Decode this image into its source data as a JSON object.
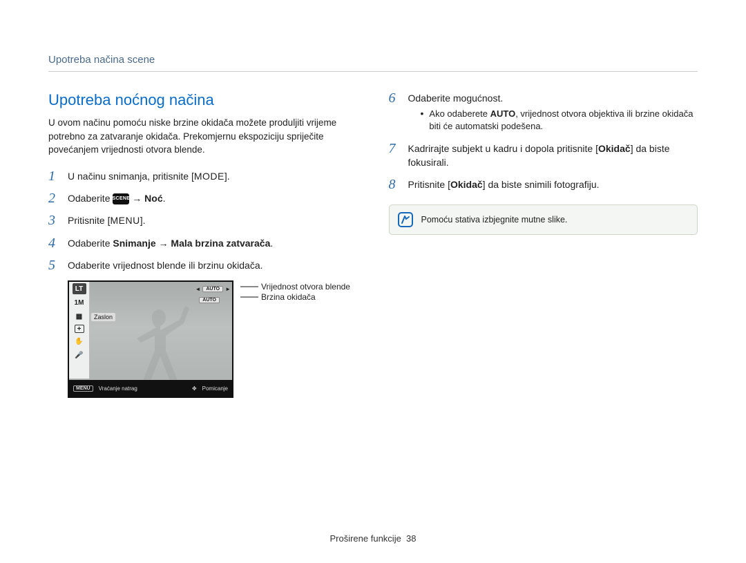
{
  "header": {
    "breadcrumb": "Upotreba načina scene"
  },
  "title": "Upotreba noćnog načina",
  "intro": "U ovom načinu pomoću niske brzine okidača možete produljiti vrijeme potrebno za zatvaranje okidača. Prekomjernu ekspoziciju spriječite povećanjem vrijednosti otvora blende.",
  "steps_left": {
    "s1_pre": "U načinu snimanja, pritisnite [",
    "s1_btn": "MODE",
    "s1_post": "].",
    "s2_pre": "Odaberite ",
    "s2_badge": "SCENE",
    "s2_arrow": " → ",
    "s2_bold": "Noć",
    "s2_post": ".",
    "s3_pre": "Pritisnite [",
    "s3_btn": "MENU",
    "s3_post": "].",
    "s4_pre": "Odaberite ",
    "s4_b1": "Snimanje",
    "s4_arrow": " → ",
    "s4_b2": "Mala brzina zatvarača",
    "s4_post": ".",
    "s5": "Odaberite vrijednost blende ili brzinu okidača."
  },
  "lcd": {
    "lt": "LT",
    "one_m": "1M",
    "zaslon": "Zaslon",
    "row1_left": "",
    "auto": "AUTO",
    "menu_label": "MENU",
    "back": "Vraćanje natrag",
    "move": "Pomicanje"
  },
  "pointers": {
    "p1": "Vrijednost otvora blende",
    "p2": "Brzina okidača"
  },
  "steps_right": {
    "s6": "Odaberite mogućnost.",
    "s6_sub_pre": "Ako odaberete ",
    "s6_sub_bold": "AUTO",
    "s6_sub_post": ", vrijednost otvora objektiva ili brzine okidača biti će automatski podešena.",
    "s7_pre": "Kadrirajte subjekt u kadru i dopola pritisnite [",
    "s7_bold": "Okidač",
    "s7_post": "] da biste fokusirali.",
    "s8_pre": "Pritisnite [",
    "s8_bold": "Okidač",
    "s8_post": "] da biste snimili fotografiju."
  },
  "note": "Pomoću stativa izbjegnite mutne slike.",
  "footer": {
    "section": "Proširene funkcije",
    "page": "38"
  },
  "nums": {
    "n1": "1",
    "n2": "2",
    "n3": "3",
    "n4": "4",
    "n5": "5",
    "n6": "6",
    "n7": "7",
    "n8": "8"
  }
}
